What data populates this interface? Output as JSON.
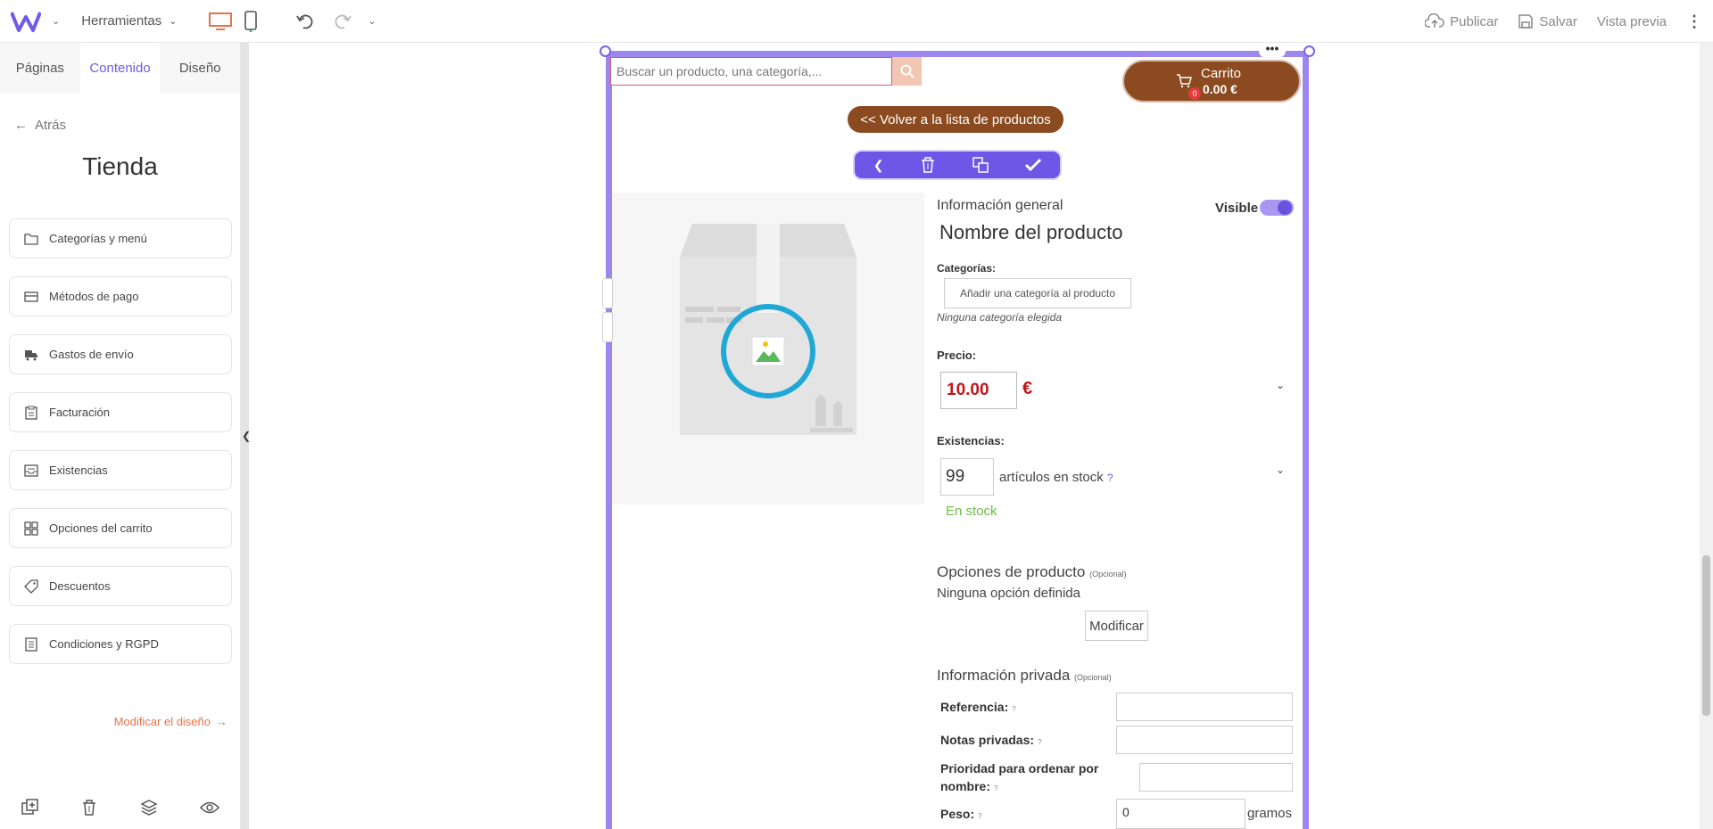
{
  "topbar": {
    "tools_label": "Herramientas",
    "publish_label": "Publicar",
    "save_label": "Salvar",
    "preview_label": "Vista previa"
  },
  "sidebar": {
    "tabs": [
      {
        "label": "Páginas"
      },
      {
        "label": "Contenido"
      },
      {
        "label": "Diseño"
      }
    ],
    "back_label": "Atrás",
    "title": "Tienda",
    "items": [
      {
        "label": "Categorías y menú",
        "icon": "folder-icon"
      },
      {
        "label": "Métodos de pago",
        "icon": "credit-card-icon"
      },
      {
        "label": "Gastos de envío",
        "icon": "truck-icon"
      },
      {
        "label": "Facturación",
        "icon": "clipboard-icon"
      },
      {
        "label": "Existencias",
        "icon": "inbox-icon"
      },
      {
        "label": "Opciones del carrito",
        "icon": "grid-icon"
      },
      {
        "label": "Descuentos",
        "icon": "tag-icon"
      },
      {
        "label": "Condiciones y RGPD",
        "icon": "document-icon"
      }
    ],
    "modify_design_label": "Modificar el diseño"
  },
  "store": {
    "search_placeholder": "Buscar un producto, una categoría,...",
    "cart_title": "Carrito",
    "cart_price": "0.00 €",
    "cart_count": "0",
    "back_to_list": "<< Volver a la lista de productos"
  },
  "product": {
    "general_info": "Información general",
    "visible_label": "Visible",
    "name": "Nombre del producto",
    "categories_label": "Categorías:",
    "add_category": "Añadir una categoría al producto",
    "no_category": "Ninguna categoría elegida",
    "price_label": "Precio:",
    "price": "10.00",
    "currency": "€",
    "stock_label": "Existencias:",
    "stock_qty": "99",
    "stock_unit": "artículos en stock",
    "stock_help": "?",
    "in_stock": "En stock",
    "options_title": "Opciones de producto",
    "optional": "(Opcional)",
    "no_options": "Ninguna opción definida",
    "modify_label": "Modificar",
    "private_title": "Información privada",
    "private_optional": "(Opcional)",
    "reference_label": "Referencia:",
    "private_notes_label": "Notas privadas:",
    "priority_label": "Prioridad para ordenar por nombre:",
    "weight_label": "Peso:",
    "weight_value": "0",
    "weight_unit": "gramos",
    "field_help": "?"
  },
  "colors": {
    "accent": "#6c5ce7",
    "brand_brown": "#8b4a1f",
    "price_red": "#c0151b",
    "stock_green": "#6dbb45",
    "frame_purple": "#9b87ee"
  }
}
